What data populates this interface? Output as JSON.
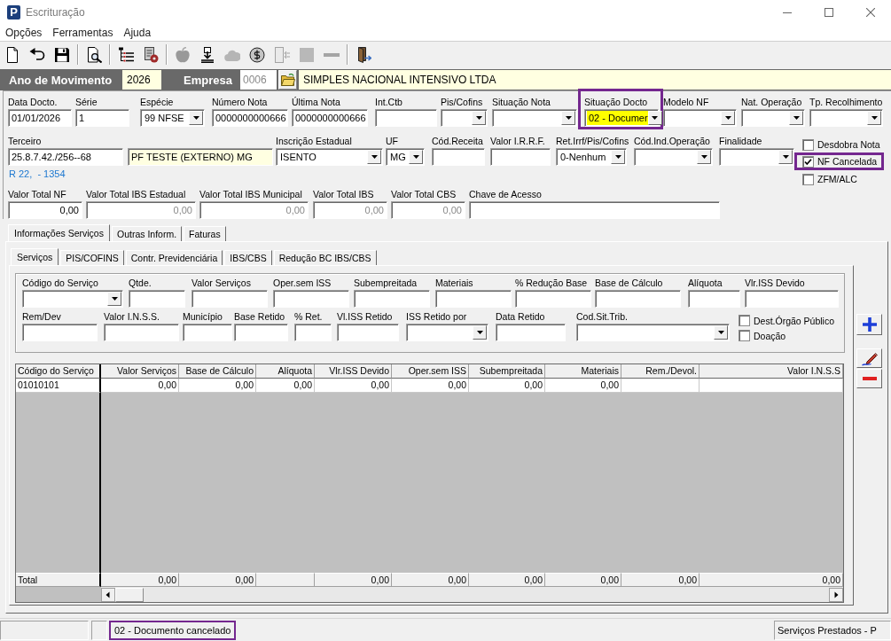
{
  "window": {
    "title": "Escrituração",
    "logo": "P"
  },
  "menu": [
    "Opções",
    "Ferramentas",
    "Ajuda"
  ],
  "toolbar": [
    [
      {
        "disabled": false
      },
      {
        "disabled": false
      },
      {
        "disabled": false
      }
    ],
    [
      {
        "disabled": false
      }
    ],
    [
      {
        "disabled": false
      },
      {
        "disabled": false
      }
    ],
    [
      {
        "disabled": true
      },
      {
        "disabled": false
      },
      {
        "disabled": true
      },
      {
        "disabled": false
      },
      {
        "disabled": true
      },
      {
        "disabled": true
      },
      {
        "disabled": true
      }
    ],
    [
      {
        "disabled": false
      }
    ]
  ],
  "header": {
    "year": {
      "label": "Ano de Movimento",
      "value": "2026"
    },
    "company": {
      "label": "Empresa",
      "code": "0006",
      "code_disabled": true,
      "name": "SIMPLES NACIONAL INTENSIVO LTDA"
    }
  },
  "document": {
    "lines": [
      {
        "fields": [
          {
            "label": "Data Docto.",
            "value": "01/01/2026",
            "kind": "text",
            "disabled": false,
            "highlighted": false,
            "outlined": false
          },
          {
            "label": "Série",
            "value": "1",
            "kind": "text",
            "disabled": false,
            "highlighted": false,
            "outlined": false
          },
          {
            "label": "Espécie",
            "value": "99 NFSE",
            "kind": "select",
            "disabled": false,
            "highlighted": false,
            "outlined": false
          },
          {
            "label": "Número Nota",
            "value": "0000000000666",
            "kind": "text",
            "disabled": false,
            "highlighted": false,
            "outlined": false
          },
          {
            "label": "Última Nota",
            "value": "0000000000666",
            "kind": "text",
            "disabled": false,
            "highlighted": false,
            "outlined": false
          },
          {
            "label": "Int.Ctb",
            "kind": "text",
            "highlighted": false,
            "outlined": false
          },
          {
            "label": "Pis/Cofins",
            "kind": "select",
            "highlighted": false,
            "outlined": false
          },
          {
            "label": "Situação Nota",
            "kind": "select",
            "highlighted": false,
            "outlined": false
          },
          {
            "label": "Situação Docto",
            "value": "02 - Documer",
            "kind": "select",
            "disabled": false,
            "highlighted": true,
            "outlined": true
          },
          {
            "label": "Modelo NF",
            "kind": "select",
            "highlighted": false,
            "outlined": false
          },
          {
            "label": "Nat. Operação",
            "kind": "select",
            "highlighted": false,
            "outlined": false
          },
          {
            "label": "Tp. Recolhimento",
            "kind": "select",
            "highlighted": false,
            "outlined": false
          }
        ]
      },
      {
        "fields": [
          {
            "label": "Terceiro",
            "value": "25.8.7.42./256--68",
            "kind": "text",
            "disabled": false,
            "highlighted": false,
            "outlined": false
          },
          {
            "value": "PF TESTE (EXTERNO) MG",
            "kind": "readonly",
            "disabled": false,
            "highlighted": false,
            "outlined": false
          },
          {
            "label": "Inscrição Estadual",
            "value": "ISENTO",
            "kind": "select",
            "disabled": false,
            "highlighted": false,
            "outlined": false
          },
          {
            "label": "UF",
            "value": "MG",
            "kind": "select",
            "disabled": false,
            "highlighted": false,
            "outlined": false
          },
          {
            "label": "Cód.Receita",
            "kind": "text",
            "highlighted": false,
            "outlined": false
          },
          {
            "label": "Valor I.R.R.F.",
            "kind": "text",
            "highlighted": false,
            "outlined": false
          },
          {
            "label": "Ret.Irrf/Pis/Cofins",
            "value": "0-Nenhum",
            "kind": "select",
            "disabled": false,
            "highlighted": false,
            "outlined": false
          },
          {
            "label": "Cód.Ind.Operação",
            "kind": "select",
            "highlighted": false,
            "outlined": false
          },
          {
            "label": "Finalidade",
            "kind": "select",
            "highlighted": false,
            "outlined": false
          }
        ]
      },
      {
        "fields": [
          {
            "label": "Valor Total NF",
            "value": "0,00",
            "kind": "number",
            "disabled": false,
            "highlighted": false,
            "outlined": false
          },
          {
            "label": "Valor Total IBS Estadual",
            "value": "0,00",
            "kind": "number",
            "disabled": true,
            "highlighted": false,
            "outlined": false
          },
          {
            "label": "Valor Total IBS Municipal",
            "value": "0,00",
            "kind": "number",
            "disabled": true,
            "highlighted": false,
            "outlined": false
          },
          {
            "label": "Valor Total IBS",
            "value": "0,00",
            "kind": "number",
            "disabled": true,
            "highlighted": false,
            "outlined": false
          },
          {
            "label": "Valor Total CBS",
            "value": "0,00",
            "kind": "number",
            "disabled": true,
            "highlighted": false,
            "outlined": false
          },
          {
            "label": "Chave de Acesso",
            "kind": "text",
            "highlighted": false,
            "outlined": false
          }
        ]
      }
    ],
    "address": "R 22,  - 1354",
    "options": [
      {
        "label": "Desdobra Nota",
        "checked": false,
        "outlined": false
      },
      {
        "label": "NF Cancelada",
        "checked": true,
        "outlined": true
      },
      {
        "label": "ZFM/ALC",
        "checked": false,
        "outlined": false
      }
    ]
  },
  "tabs": [
    {
      "label": "Informações Serviços",
      "selected": true
    },
    {
      "label": "Outras Inform.",
      "selected": false
    },
    {
      "label": "Faturas",
      "selected": false
    }
  ],
  "subtabs": [
    {
      "label": "Serviços",
      "selected": true
    },
    {
      "label": "PIS/COFINS",
      "selected": false
    },
    {
      "label": "Contr. Previdenciária",
      "selected": false
    },
    {
      "label": "IBS/CBS",
      "selected": false
    },
    {
      "label": "Redução BC IBS/CBS",
      "selected": false
    }
  ],
  "services": {
    "lines": [
      {
        "fields": [
          {
            "label": "Código do Serviço",
            "kind": "select"
          },
          {
            "label": "Qtde.",
            "kind": "text"
          },
          {
            "label": "Valor Serviços",
            "kind": "text"
          },
          {
            "label": "Oper.sem ISS",
            "kind": "text"
          },
          {
            "label": "Subempreitada",
            "kind": "text"
          },
          {
            "label": "Materiais",
            "kind": "text"
          },
          {
            "label": "% Redução Base",
            "kind": "text"
          },
          {
            "label": "Base de Cálculo",
            "kind": "text"
          },
          {
            "label": "Alíquota",
            "kind": "text"
          },
          {
            "label": "Vlr.ISS Devido",
            "kind": "text"
          }
        ]
      },
      {
        "fields": [
          {
            "label": "Rem/Dev",
            "kind": "text"
          },
          {
            "label": "Valor I.N.S.S.",
            "kind": "text"
          },
          {
            "label": "Município",
            "kind": "text"
          },
          {
            "label": "Base Retido",
            "kind": "text"
          },
          {
            "label": "% Ret.",
            "kind": "text"
          },
          {
            "label": "Vl.ISS Retido",
            "kind": "text"
          },
          {
            "label": "ISS Retido por",
            "kind": "select"
          },
          {
            "label": "Data Retido",
            "kind": "text"
          },
          {
            "label": "Cod.Sit.Trib.",
            "kind": "select"
          }
        ]
      }
    ],
    "options": [
      {
        "label": "Dest.Órgão Público",
        "checked": false
      },
      {
        "label": "Doação",
        "checked": false
      }
    ]
  },
  "table": {
    "columns": [
      "Código do Serviço",
      "Valor Serviços",
      "Base de Cálculo",
      "Alíquota",
      "Vlr.ISS Devido",
      "Oper.sem ISS",
      "Subempreitada",
      "Materiais",
      "Rem./Devol.",
      "Valor I.N.S.S"
    ],
    "rows": [
      {
        "codigo_do_servico": "01010101",
        "valor_servicos": "0,00",
        "base_de_calculo": "0,00",
        "aliquota": "0,00",
        "vlr_iss_devido": "0,00",
        "oper_sem_iss": "0,00",
        "subempreitada": "0,00",
        "materiais": "0,00"
      }
    ],
    "total": {
      "codigo_do_servico": "Total",
      "valor_servicos": "0,00",
      "base_de_calculo": "0,00",
      "vlr_iss_devido": "0,00",
      "oper_sem_iss": "0,00",
      "subempreitada": "0,00",
      "materiais": "0,00",
      "rem_devol": "0,00",
      "valor_inss": "0,00"
    }
  },
  "status_bar": [
    {
      "text": "02 - Documento cancelado",
      "outlined": true
    },
    {
      "text": "Serviços Prestados - P",
      "outlined": false
    }
  ]
}
